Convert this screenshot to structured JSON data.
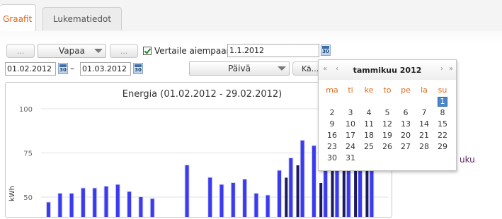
{
  "tabs": [
    {
      "label": "Graafit",
      "active": true
    },
    {
      "label": "Lukematiedot",
      "active": false
    }
  ],
  "toolbar": {
    "prev_label": "...",
    "period_select": "Vapaa",
    "next_label": "...",
    "compare_checked": true,
    "compare_label": "Vertaile aiempaan",
    "compare_date": "1.1.2012",
    "start_date": "01.02.2012",
    "range_separator": "–",
    "end_date": "01.03.2012",
    "resolution_select": "Päivä",
    "action_button": "Kä...",
    "calendar_icon_text": "30"
  },
  "chart_data": {
    "type": "bar",
    "title": "Energia (01.02.2012 - 29.02.2012)",
    "ylabel": "kWh",
    "xlabel": "",
    "ylim": [
      40,
      100
    ],
    "y_ticks": [
      50,
      75,
      100
    ],
    "grid": true,
    "series": [
      {
        "color": "#3a3af0",
        "values": [
          47,
          52,
          52,
          55,
          55,
          56,
          57,
          53,
          50,
          49,
          0,
          0,
          68,
          0,
          61,
          57,
          58,
          60,
          52,
          51,
          65,
          72,
          82,
          79,
          90,
          89,
          81,
          79,
          71
        ]
      },
      {
        "color": "#1a1a5c",
        "values": [
          0,
          0,
          0,
          0,
          0,
          0,
          0,
          0,
          0,
          0,
          0,
          0,
          0,
          0,
          0,
          0,
          0,
          0,
          0,
          0,
          0,
          61,
          68,
          0,
          58,
          65,
          72,
          74,
          66
        ]
      }
    ]
  },
  "calendar": {
    "title": "tammikuu 2012",
    "nav_prev_year": "«",
    "nav_prev_month": "‹",
    "nav_next_month": "›",
    "nav_next_year": "»",
    "weekdays": [
      "ma",
      "ti",
      "ke",
      "to",
      "pe",
      "la",
      "su"
    ],
    "selected_day": "1",
    "weeks": [
      [
        "",
        "",
        "",
        "",
        "",
        "",
        "1"
      ],
      [
        "2",
        "3",
        "4",
        "5",
        "6",
        "7",
        "8"
      ],
      [
        "9",
        "10",
        "11",
        "12",
        "13",
        "14",
        "15"
      ],
      [
        "16",
        "17",
        "18",
        "19",
        "20",
        "21",
        "22"
      ],
      [
        "23",
        "24",
        "25",
        "26",
        "27",
        "28",
        "29"
      ],
      [
        "30",
        "31",
        "",
        "",
        "",
        "",
        ""
      ]
    ]
  },
  "side_text": "uku"
}
